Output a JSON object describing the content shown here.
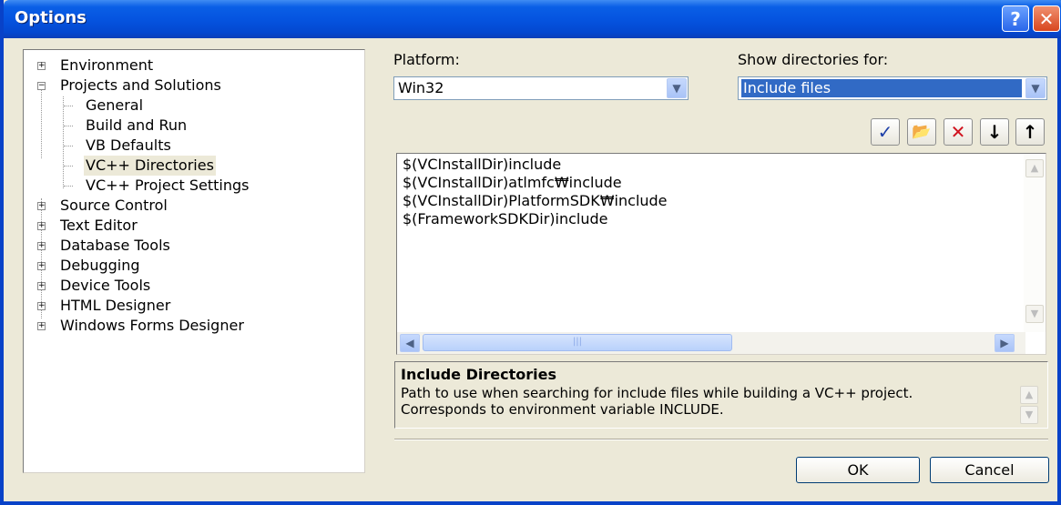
{
  "window": {
    "title": "Options"
  },
  "titlebar": {
    "help_glyph": "?",
    "close_glyph": "✕"
  },
  "tree": {
    "items": [
      {
        "label": "Environment",
        "expander": "+"
      },
      {
        "label": "Projects and Solutions",
        "expander": "−"
      },
      {
        "label": "General"
      },
      {
        "label": "Build and Run"
      },
      {
        "label": "VB Defaults"
      },
      {
        "label": "VC++ Directories",
        "selected": true
      },
      {
        "label": "VC++ Project Settings"
      },
      {
        "label": "Source Control",
        "expander": "+"
      },
      {
        "label": "Text Editor",
        "expander": "+"
      },
      {
        "label": "Database Tools",
        "expander": "+"
      },
      {
        "label": "Debugging",
        "expander": "+"
      },
      {
        "label": "Device Tools",
        "expander": "+"
      },
      {
        "label": "HTML Designer",
        "expander": "+"
      },
      {
        "label": "Windows Forms Designer",
        "expander": "+"
      }
    ]
  },
  "platform": {
    "label": "Platform:",
    "value": "Win32"
  },
  "show_dirs": {
    "label": "Show directories for:",
    "value": "Include files"
  },
  "toolbar": {
    "check_glyph": "✓",
    "newfolder_glyph": "📂",
    "delete_glyph": "✕",
    "down_glyph": "↓",
    "up_glyph": "↑"
  },
  "directories": [
    "$(VCInstallDir)include",
    "$(VCInstallDir)atlmfc₩include",
    "$(VCInstallDir)PlatformSDK₩include",
    "$(FrameworkSDKDir)include"
  ],
  "description": {
    "title": "Include Directories",
    "line1": "Path to use when searching for include files while building a VC++ project.",
    "line2": "Corresponds to environment variable INCLUDE."
  },
  "buttons": {
    "ok": "OK",
    "cancel": "Cancel"
  },
  "colors": {
    "titlebar": "#0554e0",
    "selection": "#316ac5"
  }
}
